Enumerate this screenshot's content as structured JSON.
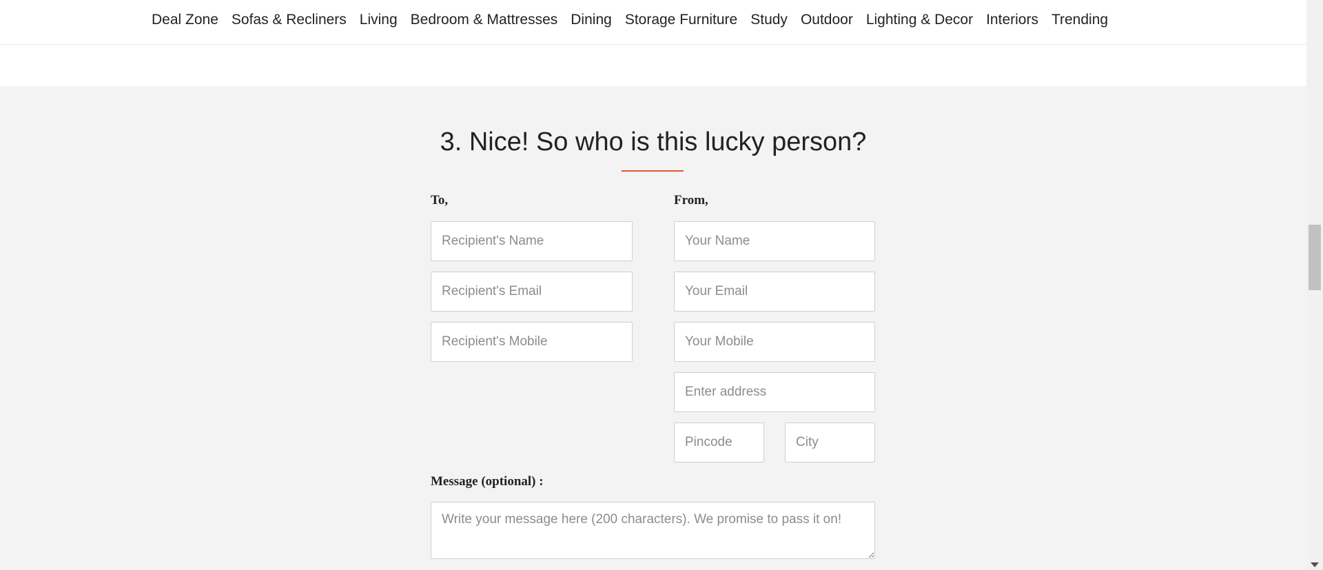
{
  "nav": {
    "items": [
      "Deal Zone",
      "Sofas & Recliners",
      "Living",
      "Bedroom & Mattresses",
      "Dining",
      "Storage Furniture",
      "Study",
      "Outdoor",
      "Lighting & Decor",
      "Interiors",
      "Trending"
    ]
  },
  "section": {
    "title": "3. Nice! So who is this lucky person?",
    "accent_color": "#e4582c"
  },
  "to": {
    "label": "To,",
    "name_placeholder": "Recipient's Name",
    "email_placeholder": "Recipient's Email",
    "mobile_placeholder": "Recipient's Mobile"
  },
  "from": {
    "label": "From,",
    "name_placeholder": "Your Name",
    "email_placeholder": "Your Email",
    "mobile_placeholder": "Your Mobile",
    "address_placeholder": "Enter address",
    "pincode_placeholder": "Pincode",
    "city_placeholder": "City"
  },
  "message": {
    "label": "Message (optional) :",
    "placeholder": "Write your message here (200 characters). We promise to pass it on!"
  }
}
